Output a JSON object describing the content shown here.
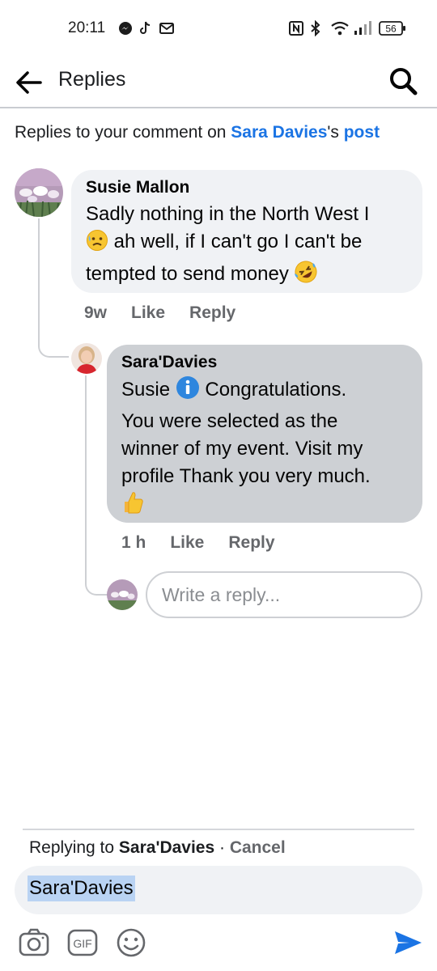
{
  "status_bar": {
    "time": "20:11",
    "battery": "56",
    "icons": [
      "messenger-icon",
      "tiktok-icon",
      "mail-icon",
      "nfc-icon",
      "bluetooth-icon",
      "wifi-icon",
      "signal-icon",
      "battery-icon"
    ]
  },
  "header": {
    "title": "Replies",
    "back_icon": "arrow-left-icon",
    "search_icon": "search-icon"
  },
  "context": {
    "prefix": "Replies to your comment on ",
    "name": "Sara Davies",
    "possessive": "'s ",
    "link": "post"
  },
  "comment1": {
    "author": "Susie Mallon",
    "text_a": "Sadly nothing in the North West I",
    "text_b": " ah well, if I can't go I can't be",
    "text_c": "tempted to send money ",
    "time": "9w",
    "like": "Like",
    "reply": "Reply"
  },
  "comment2": {
    "author": "Sara'Davies",
    "text_a": "Susie ",
    "text_b": " Congratulations.",
    "text_c": "You were selected as the",
    "text_d": "winner of my event. Visit my",
    "text_e": "profile Thank you very much.",
    "time": "1 h",
    "like": "Like",
    "reply": "Reply"
  },
  "write_reply": {
    "placeholder": "Write a reply..."
  },
  "composer": {
    "replying_prefix": "Replying to ",
    "replying_name": "Sara'Davies",
    "separator": " · ",
    "cancel": "Cancel",
    "value": "Sara'Davies",
    "tools": [
      "camera-icon",
      "gif-icon",
      "emoji-icon",
      "send-icon"
    ],
    "gif_label": "GIF"
  },
  "colors": {
    "link_blue": "#1b74e4",
    "bubble_gray": "#f0f2f5",
    "bubble_highlight": "#cdd0d4",
    "meta_gray": "#65676b",
    "send_blue": "#1b74e4"
  }
}
